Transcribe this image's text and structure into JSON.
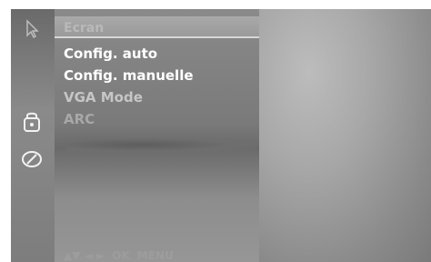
{
  "menu": {
    "title": "Ecran",
    "items": [
      {
        "label": "Config. auto",
        "state": "active"
      },
      {
        "label": "Config. manuelle",
        "state": "active"
      },
      {
        "label": "VGA Mode",
        "state": "dim"
      },
      {
        "label": "ARC",
        "state": "disabled"
      }
    ]
  },
  "footer": {
    "nav_glyphs": "▲▼ ◄ ►",
    "ok_label": "OK",
    "menu_label": "MENU"
  },
  "icons": {
    "rail": [
      "cursor-icon",
      "lock-icon",
      "clock-icon"
    ]
  },
  "colors": {
    "panel_gray": "#7a7a7a",
    "text_active": "#ffffff",
    "text_disabled": "#a8a8a8"
  }
}
